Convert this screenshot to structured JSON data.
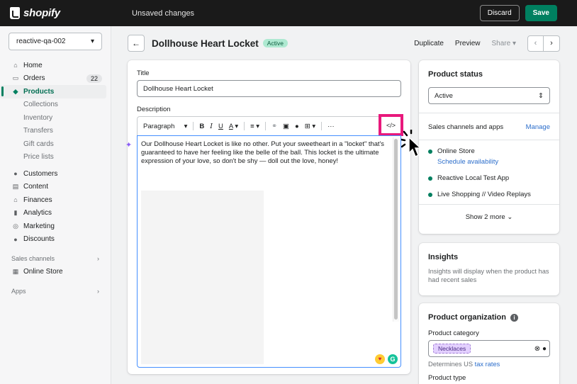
{
  "topbar": {
    "brand": "shopify",
    "status": "Unsaved changes",
    "discard_label": "Discard",
    "save_label": "Save"
  },
  "sidebar": {
    "store": "reactive-qa-002",
    "items": [
      {
        "label": "Home",
        "icon": "home-icon"
      },
      {
        "label": "Orders",
        "icon": "orders-icon",
        "badge": "22"
      },
      {
        "label": "Products",
        "icon": "tag-icon"
      },
      {
        "label": "Collections"
      },
      {
        "label": "Inventory"
      },
      {
        "label": "Transfers"
      },
      {
        "label": "Gift cards"
      },
      {
        "label": "Price lists"
      },
      {
        "label": "Customers",
        "icon": "person-icon"
      },
      {
        "label": "Content",
        "icon": "content-icon"
      },
      {
        "label": "Finances",
        "icon": "bank-icon"
      },
      {
        "label": "Analytics",
        "icon": "bar-chart-icon"
      },
      {
        "label": "Marketing",
        "icon": "target-icon"
      },
      {
        "label": "Discounts",
        "icon": "discount-icon"
      }
    ],
    "sales_channels_label": "Sales channels",
    "online_store": "Online Store",
    "apps_label": "Apps"
  },
  "header": {
    "title": "Dollhouse Heart Locket",
    "status": "Active",
    "duplicate": "Duplicate",
    "preview": "Preview",
    "share": "Share"
  },
  "product": {
    "title_label": "Title",
    "title_value": "Dollhouse Heart Locket",
    "description_label": "Description",
    "toolbar_format": "Paragraph",
    "description": "Our Dollhouse Heart Locket is like no other. Put your sweetheart in a \"locket\" that's guaranteed to have her feeling like the belle of the ball. This locket is the ultimate expression of your love, so don't be shy — doll out the love, honey!"
  },
  "status_card": {
    "title": "Product status",
    "status_value": "Active",
    "channels_title": "Sales channels and apps",
    "manage": "Manage",
    "channels": [
      "Online Store",
      "Reactive Local Test App",
      "Live Shopping // Video Replays"
    ],
    "schedule": "Schedule availability",
    "show_more": "Show 2 more"
  },
  "insights": {
    "title": "Insights",
    "text": "Insights will display when the product has had recent sales"
  },
  "organization": {
    "title": "Product organization",
    "category_label": "Product category",
    "category_value": "Necklaces",
    "tax_prefix": "Determines US",
    "tax_link": "tax rates",
    "type_label": "Product type"
  },
  "colors": {
    "accent": "#008060",
    "highlight": "#e8197c",
    "link": "#2c6ecb"
  }
}
